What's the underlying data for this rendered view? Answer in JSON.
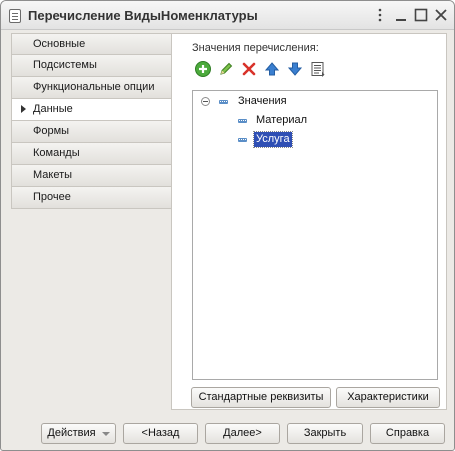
{
  "window": {
    "title": "Перечисление ВидыНоменклатуры"
  },
  "nav": {
    "items": [
      {
        "label": "Основные"
      },
      {
        "label": "Подсистемы"
      },
      {
        "label": "Функциональные опции"
      },
      {
        "label": "Данные",
        "active": true
      },
      {
        "label": "Формы"
      },
      {
        "label": "Команды"
      },
      {
        "label": "Макеты"
      },
      {
        "label": "Прочее"
      }
    ]
  },
  "panel": {
    "label": "Значения перечисления:",
    "toolbar": {
      "icons": [
        "add-icon",
        "edit-icon",
        "delete-icon",
        "move-up-icon",
        "move-down-icon",
        "list-icon"
      ]
    },
    "tree": {
      "root": "Значения",
      "children": [
        {
          "label": "Материал"
        },
        {
          "label": "Услуга",
          "selected": true
        }
      ]
    },
    "buttons": {
      "standard_attrs": "Стандартные реквизиты",
      "characteristics": "Характеристики"
    }
  },
  "footer": {
    "actions": "Действия",
    "back": "<Назад",
    "next": "Далее>",
    "close": "Закрыть",
    "help": "Справка"
  },
  "colors": {
    "selection": "#2f4fb4",
    "add_green": "#4caa3c",
    "delete_red": "#d8322a",
    "arrow_blue": "#3a7fd0"
  }
}
